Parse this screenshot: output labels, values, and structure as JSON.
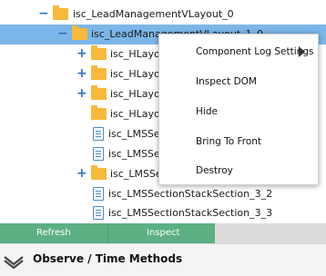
{
  "tree": {
    "rows": [
      {
        "toggle": "−",
        "icon": "folder",
        "label": "isc_LeadManagementVLayout_0"
      },
      {
        "toggle": "−",
        "icon": "folder",
        "label": "isc_LeadManagementVLayout_1_0"
      },
      {
        "toggle": "+",
        "icon": "folder",
        "label": "isc_HLayout_3"
      },
      {
        "toggle": "+",
        "icon": "folder",
        "label": "isc_HLayout_2"
      },
      {
        "toggle": "+",
        "icon": "folder",
        "label": "isc_HLayout_0"
      },
      {
        "toggle": "",
        "icon": "folder",
        "label": "isc_HLayout_1"
      },
      {
        "toggle": "",
        "icon": "doc",
        "label": "isc_LMSSection"
      },
      {
        "toggle": "",
        "icon": "doc",
        "label": "isc_LMSSection"
      },
      {
        "toggle": "+",
        "icon": "folder",
        "label": "isc_LMSSection"
      },
      {
        "toggle": "",
        "icon": "doc",
        "label": "isc_LMSSectionStackSection_3_2"
      },
      {
        "toggle": "",
        "icon": "doc",
        "label": "isc_LMSSectionStackSection_3_3"
      }
    ]
  },
  "context_menu": {
    "items": [
      "Component Log Settings",
      "Inspect DOM",
      "Hide",
      "Bring To Front",
      "Destroy"
    ]
  },
  "buttons": {
    "refresh": "Refresh",
    "inspect": "Inspect"
  },
  "section": {
    "title": "Observe / Time Methods"
  }
}
